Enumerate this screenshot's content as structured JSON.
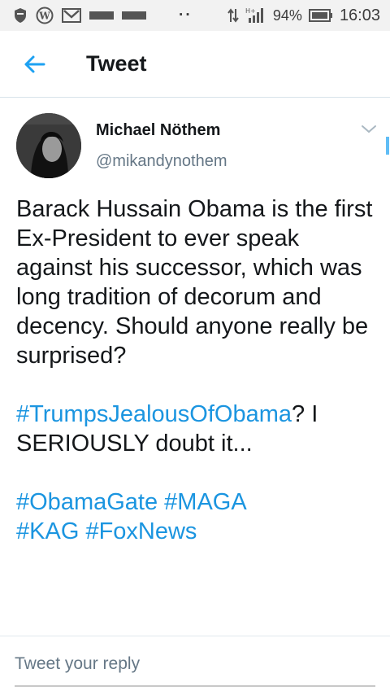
{
  "status_bar": {
    "dots": "··",
    "battery_percent": "94%",
    "time": "16:03",
    "icons": [
      "shield-icon",
      "wordpress-icon",
      "gmail-icon",
      "notification-bar-icon",
      "notification-bar-icon",
      "data-transfer-icon",
      "signal-icon",
      "battery-icon"
    ]
  },
  "app_bar": {
    "title": "Tweet",
    "back_icon": "arrow-left-icon",
    "accent_color": "#1da1f2"
  },
  "tweet": {
    "author_name": "Michael Nöthem",
    "author_handle": "@mikandynothem",
    "menu_icon": "chevron-down-icon",
    "lines": {
      "p1": "Barack Hussain Obama is the first Ex-President to ever speak against his successor, which was long tradition of decorum and decency. Should anyone really be surprised?",
      "hashtag1": "#TrumpsJealousOfObama",
      "p2_rest": "? I SERIOUSLY doubt it...",
      "hashtag2": "#ObamaGate",
      "hashtag3": "#MAGA",
      "hashtag4": "#KAG",
      "hashtag5": "#FoxNews"
    },
    "hashtag_color": "#1b95e0"
  },
  "reply": {
    "placeholder": "Tweet your reply"
  }
}
